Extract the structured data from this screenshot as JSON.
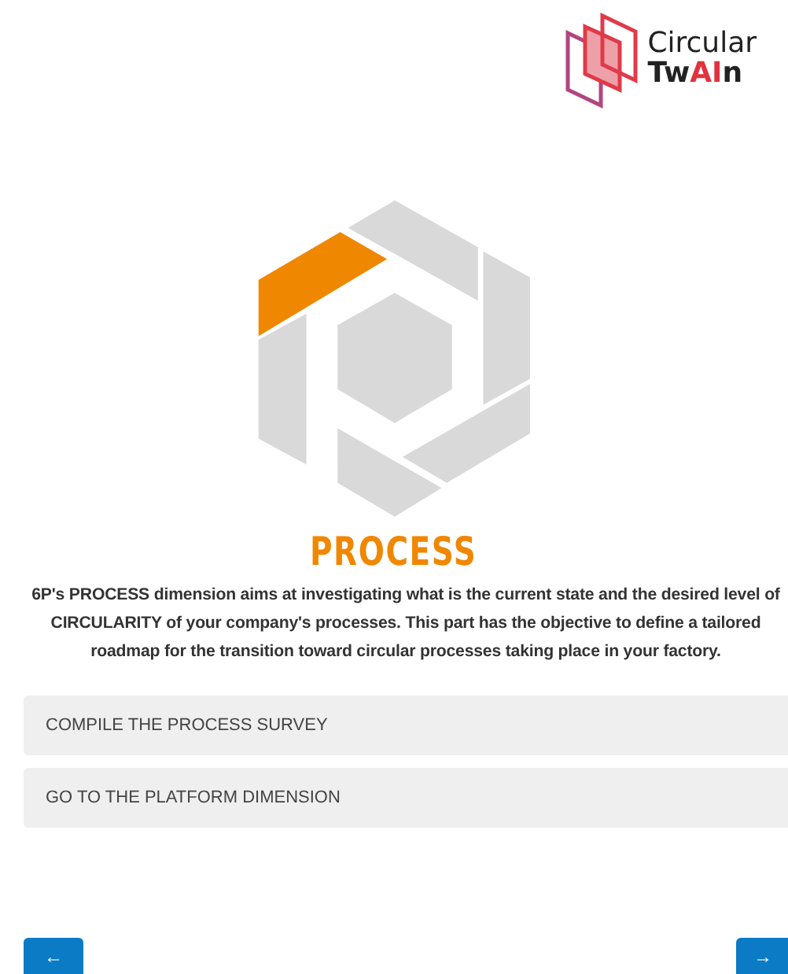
{
  "brand": {
    "line_1": "Circular",
    "line_2": [
      {
        "text": "Tw",
        "accent": false
      },
      {
        "text": "AI",
        "accent": true
      },
      {
        "text": "n",
        "accent": false
      }
    ]
  },
  "dimension": {
    "title": "PROCESS",
    "description": "6P's PROCESS dimension aims at investigating what is the current state and the desired level of CIRCULARITY of your company's processes. This part has the objective to define a tailored roadmap for the transition toward circular processes taking place in your factory."
  },
  "options": [
    {
      "label": "COMPILE THE PROCESS SURVEY"
    },
    {
      "label": "GO TO THE PLATFORM DIMENSION"
    }
  ],
  "nav_buttons": [
    {
      "kind": "back",
      "label": "←"
    },
    {
      "kind": "next",
      "label": "→"
    }
  ]
}
